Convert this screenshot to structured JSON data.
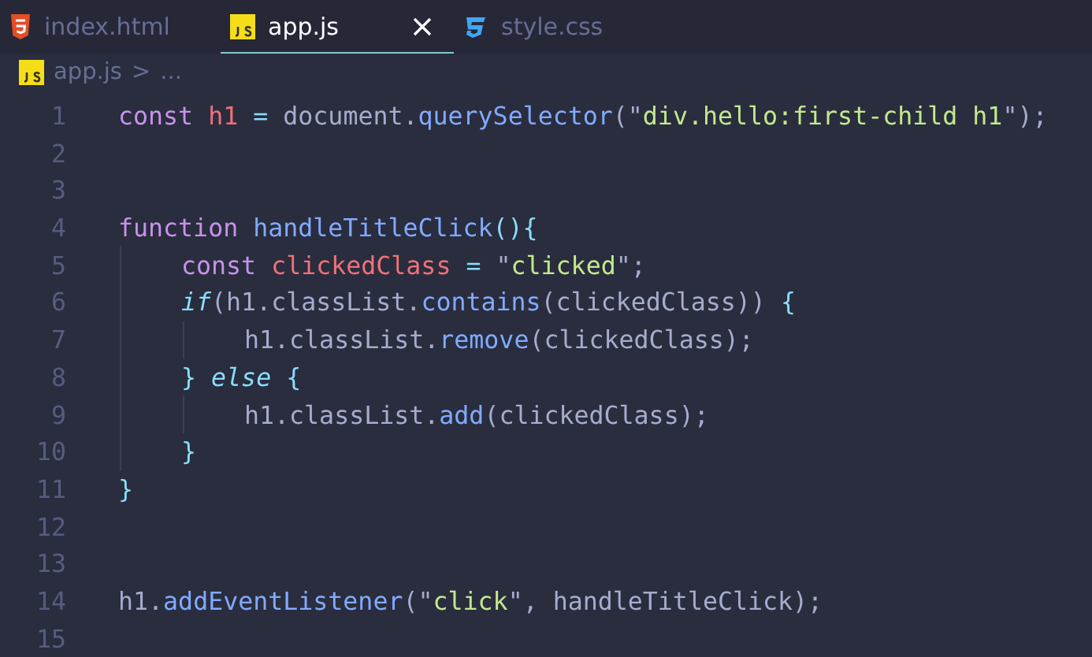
{
  "tabs": [
    {
      "label": "index.html",
      "kind": "html",
      "selected": false,
      "closable": false
    },
    {
      "label": "app.js",
      "kind": "js",
      "selected": true,
      "closable": true
    },
    {
      "label": "style.css",
      "kind": "css",
      "selected": false,
      "closable": false
    }
  ],
  "breadcrumb": {
    "kind": "js",
    "file": "app.js",
    "separator": ">",
    "rest": "..."
  },
  "lines": [
    {
      "number": "1",
      "tokens": [
        {
          "kind": "keyword",
          "text": "const"
        },
        {
          "kind": "variable",
          "text": " h1"
        },
        {
          "kind": "punct",
          "text": " ="
        },
        {
          "kind": "plain",
          "text": " document."
        },
        {
          "kind": "function",
          "text": "querySelector"
        },
        {
          "kind": "plain",
          "text": "(\""
        },
        {
          "kind": "string",
          "text": "div.hello:first-child h1"
        },
        {
          "kind": "plain",
          "text": "\");"
        }
      ]
    },
    {
      "number": "2"
    },
    {
      "number": "3"
    },
    {
      "number": "4",
      "tokens": [
        {
          "kind": "keyword",
          "text": "function"
        },
        {
          "kind": "function",
          "text": " handleTitleClick"
        },
        {
          "kind": "punct",
          "text": "(){"
        }
      ],
      "children": [
        {
          "number": "5",
          "tokens": [
            {
              "kind": "keyword",
              "text": "const"
            },
            {
              "kind": "variable",
              "text": " clickedClass"
            },
            {
              "kind": "punct",
              "text": " ="
            },
            {
              "kind": "plain",
              "text": " \""
            },
            {
              "kind": "string",
              "text": "clicked"
            },
            {
              "kind": "plain",
              "text": "\";"
            }
          ]
        },
        {
          "number": "6",
          "tokens": [
            {
              "kind": "control",
              "text": "if"
            },
            {
              "kind": "plain",
              "text": "(h1.classList."
            },
            {
              "kind": "function",
              "text": "contains"
            },
            {
              "kind": "plain",
              "text": "(clickedClass)) "
            },
            {
              "kind": "punct",
              "text": "{"
            }
          ],
          "children": [
            {
              "number": "7",
              "tokens": [
                {
                  "kind": "plain",
                  "text": "h1.classList."
                },
                {
                  "kind": "function",
                  "text": "remove"
                },
                {
                  "kind": "plain",
                  "text": "(clickedClass);"
                }
              ]
            }
          ]
        },
        {
          "number": "8",
          "tokens": [
            {
              "kind": "punct",
              "text": "} "
            },
            {
              "kind": "control",
              "text": "else"
            },
            {
              "kind": "punct",
              "text": " {"
            }
          ],
          "children": [
            {
              "number": "9",
              "tokens": [
                {
                  "kind": "plain",
                  "text": "h1.classList."
                },
                {
                  "kind": "function",
                  "text": "add"
                },
                {
                  "kind": "plain",
                  "text": "(clickedClass);"
                }
              ]
            }
          ]
        },
        {
          "number": "10",
          "tokens": [
            {
              "kind": "punct",
              "text": "}"
            }
          ]
        }
      ]
    },
    {
      "number": "11",
      "tokens": [
        {
          "kind": "punct",
          "text": "}"
        }
      ]
    },
    {
      "number": "12"
    },
    {
      "number": "13"
    },
    {
      "number": "14",
      "tokens": [
        {
          "kind": "plain",
          "text": "h1."
        },
        {
          "kind": "function",
          "text": "addEventListener"
        },
        {
          "kind": "plain",
          "text": "(\""
        },
        {
          "kind": "string",
          "text": "click"
        },
        {
          "kind": "plain",
          "text": "\", handleTitleClick);"
        }
      ]
    },
    {
      "number": "15"
    }
  ]
}
